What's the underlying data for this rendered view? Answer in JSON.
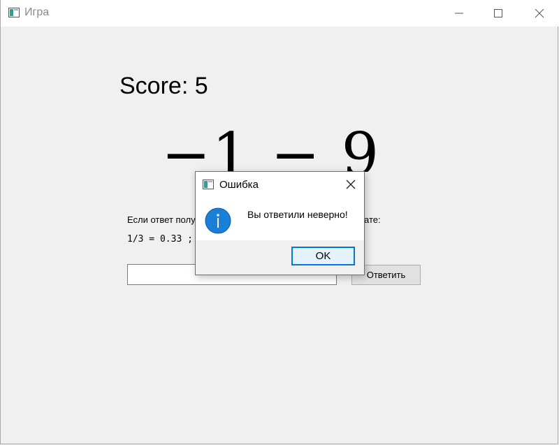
{
  "window": {
    "title": "Игра"
  },
  "game": {
    "score_label": "Score: 5",
    "expression": "−1 − 9 =",
    "hint_line1": "Если ответ получ",
    "hint_line1_right": "ате:",
    "hint_line2": "1/3 = 0.33 ; 2/3",
    "answer_value": "",
    "answer_button": "Ответить"
  },
  "dialog": {
    "title": "Ошибка",
    "message": "Вы ответили неверно!",
    "ok_label": "OK",
    "icon": "info-icon"
  },
  "colors": {
    "accent": "#0078d7",
    "info_blue": "#1a7fd6"
  }
}
